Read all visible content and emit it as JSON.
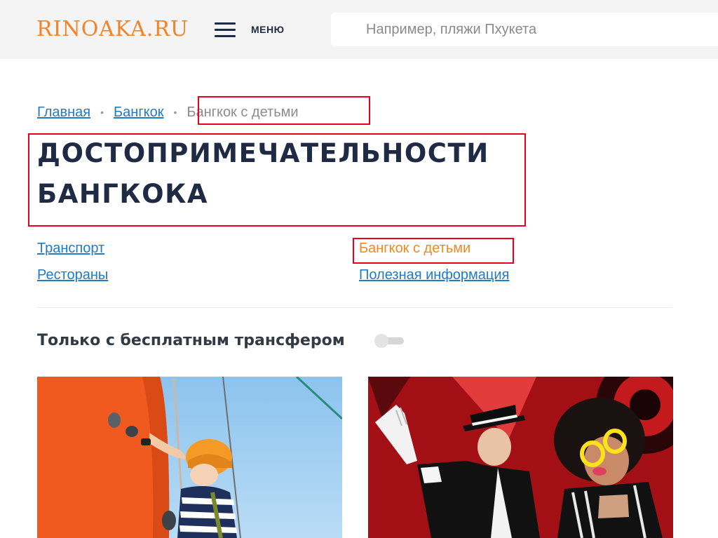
{
  "header": {
    "logo": "RINOAKA.RU",
    "menu_label": "МЕНЮ",
    "search_placeholder": "Например, пляжи Пхукета"
  },
  "breadcrumb": {
    "items": [
      "Главная",
      "Бангкок"
    ],
    "current": "Бангкок с детьми"
  },
  "page": {
    "title": "ДОСТОПРИМЕЧАТЕЛЬНОСТИ БАНГКОКА"
  },
  "sublinks": [
    {
      "label": "Транспорт",
      "active": false
    },
    {
      "label": "Рестораны",
      "active": false
    },
    {
      "label": "Бангкок с детьми",
      "active": true
    },
    {
      "label": "Полезная информация",
      "active": false
    }
  ],
  "filter": {
    "label": "Только с бесплатным трансфером",
    "enabled": false
  },
  "colors": {
    "brand_orange": "#f0842a",
    "link_blue": "#1f7bc3",
    "active_orange": "#f08a1e",
    "title_navy": "#1f2a44",
    "highlight_red": "#e8001c"
  },
  "icons": [
    "menu-icon"
  ]
}
